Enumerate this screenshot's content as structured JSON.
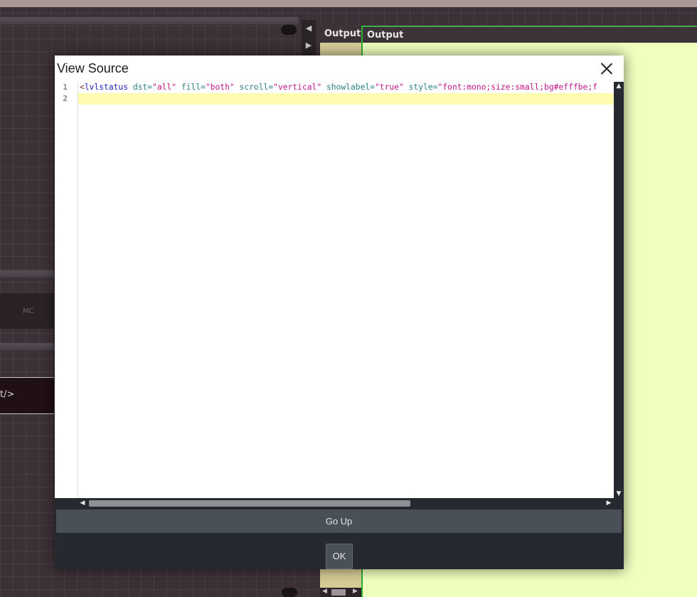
{
  "background": {
    "out_labels": [
      "Output",
      "Output"
    ],
    "mc_label": "MC",
    "fragment_text": "t/>",
    "colors": {
      "panel_yellow": "#efffbe",
      "accent_green": "#2fae2f",
      "tan": "#d6cc97"
    }
  },
  "dialog": {
    "title": "View Source",
    "line_numbers": [
      "1",
      "2"
    ],
    "code": {
      "open": "<",
      "tag": "lvlstatus",
      "attrs": [
        {
          "name": " dst",
          "value": "\"all\""
        },
        {
          "name": " fill",
          "value": "\"both\""
        },
        {
          "name": " scroll",
          "value": "\"vertical\""
        },
        {
          "name": " showlabel",
          "value": "\"true\""
        },
        {
          "name": " style",
          "value": "\"font:mono;size:small;bg#efffbe;f"
        }
      ]
    },
    "go_up_label": "Go Up",
    "ok_label": "OK"
  }
}
